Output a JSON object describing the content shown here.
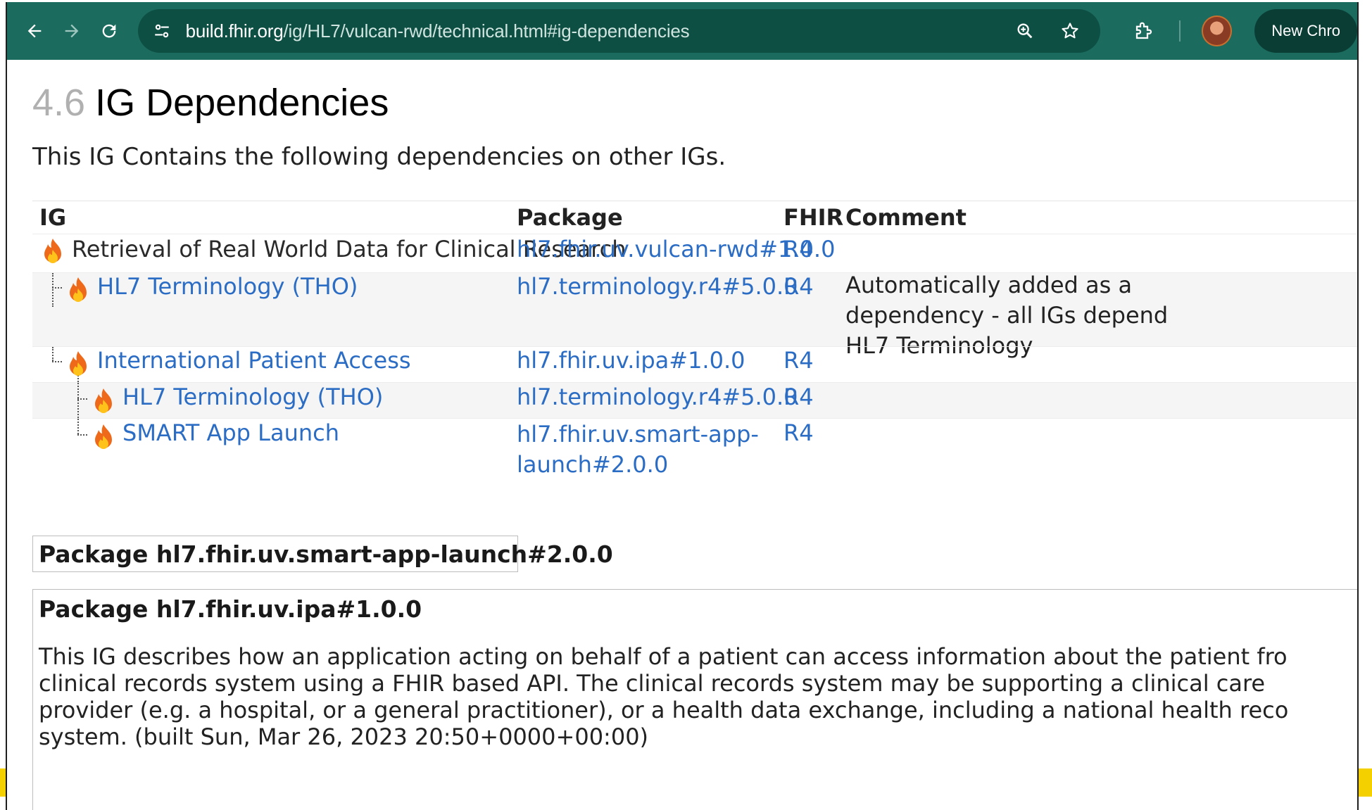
{
  "browser": {
    "url_host": "build.fhir.org",
    "url_path": "/ig/HL7/vulcan-rwd/technical.html#ig-dependencies",
    "new_chrome_label": "New Chro",
    "icons": [
      "back-arrow-icon",
      "forward-arrow-icon",
      "reload-icon",
      "site-info-icon",
      "zoom-icon",
      "star-icon",
      "extensions-icon",
      "profile-avatar"
    ]
  },
  "page": {
    "section_number": "4.6",
    "section_title": "IG Dependencies",
    "intro": "This IG Contains the following dependencies on other IGs."
  },
  "table": {
    "headers": {
      "ig": "IG",
      "package": "Package",
      "fhir": "FHIR",
      "comment": "Comment"
    },
    "rows": [
      {
        "ig": "Retrieval of Real World Data for Clinical Research",
        "package": "hl7.fhir.uv.vulcan-rwd#1.0.0",
        "fhir": "R4",
        "comment": ""
      },
      {
        "ig": "HL7 Terminology (THO)",
        "package": "hl7.terminology.r4#5.0.0",
        "fhir": "R4",
        "comment_lines": [
          "Automatically added as a",
          "dependency - all IGs depend",
          "HL7 Terminology"
        ]
      },
      {
        "ig": "International Patient Access",
        "package": "hl7.fhir.uv.ipa#1.0.0",
        "fhir": "R4",
        "comment": ""
      },
      {
        "ig": "HL7 Terminology (THO)",
        "package": "hl7.terminology.r4#5.0.0",
        "fhir": "R4",
        "comment": ""
      },
      {
        "ig": "SMART App Launch",
        "package_lines": [
          "hl7.fhir.uv.smart-app-",
          "launch#2.0.0"
        ],
        "fhir": "R4",
        "comment": ""
      }
    ]
  },
  "packages": {
    "smart": {
      "title": "Package hl7.fhir.uv.smart-app-launch#2.0.0"
    },
    "ipa": {
      "title": "Package hl7.fhir.uv.ipa#1.0.0",
      "description_lines": [
        "This IG describes how an application acting on behalf of a patient can access information about the patient fro",
        "clinical records system using a FHIR based API. The clinical records system may be supporting a clinical care",
        "provider (e.g. a hospital, or a general practitioner), or a health data exchange, including a national health reco",
        "system. (built Sun, Mar 26, 2023 20:50+0000+00:00)"
      ]
    }
  },
  "colors": {
    "toolbar": "#1b6b5e",
    "omnibox": "#0e4f44",
    "link": "#2b6cc4",
    "alt_row": "#f5f5f5",
    "marker": "#f5d000"
  }
}
